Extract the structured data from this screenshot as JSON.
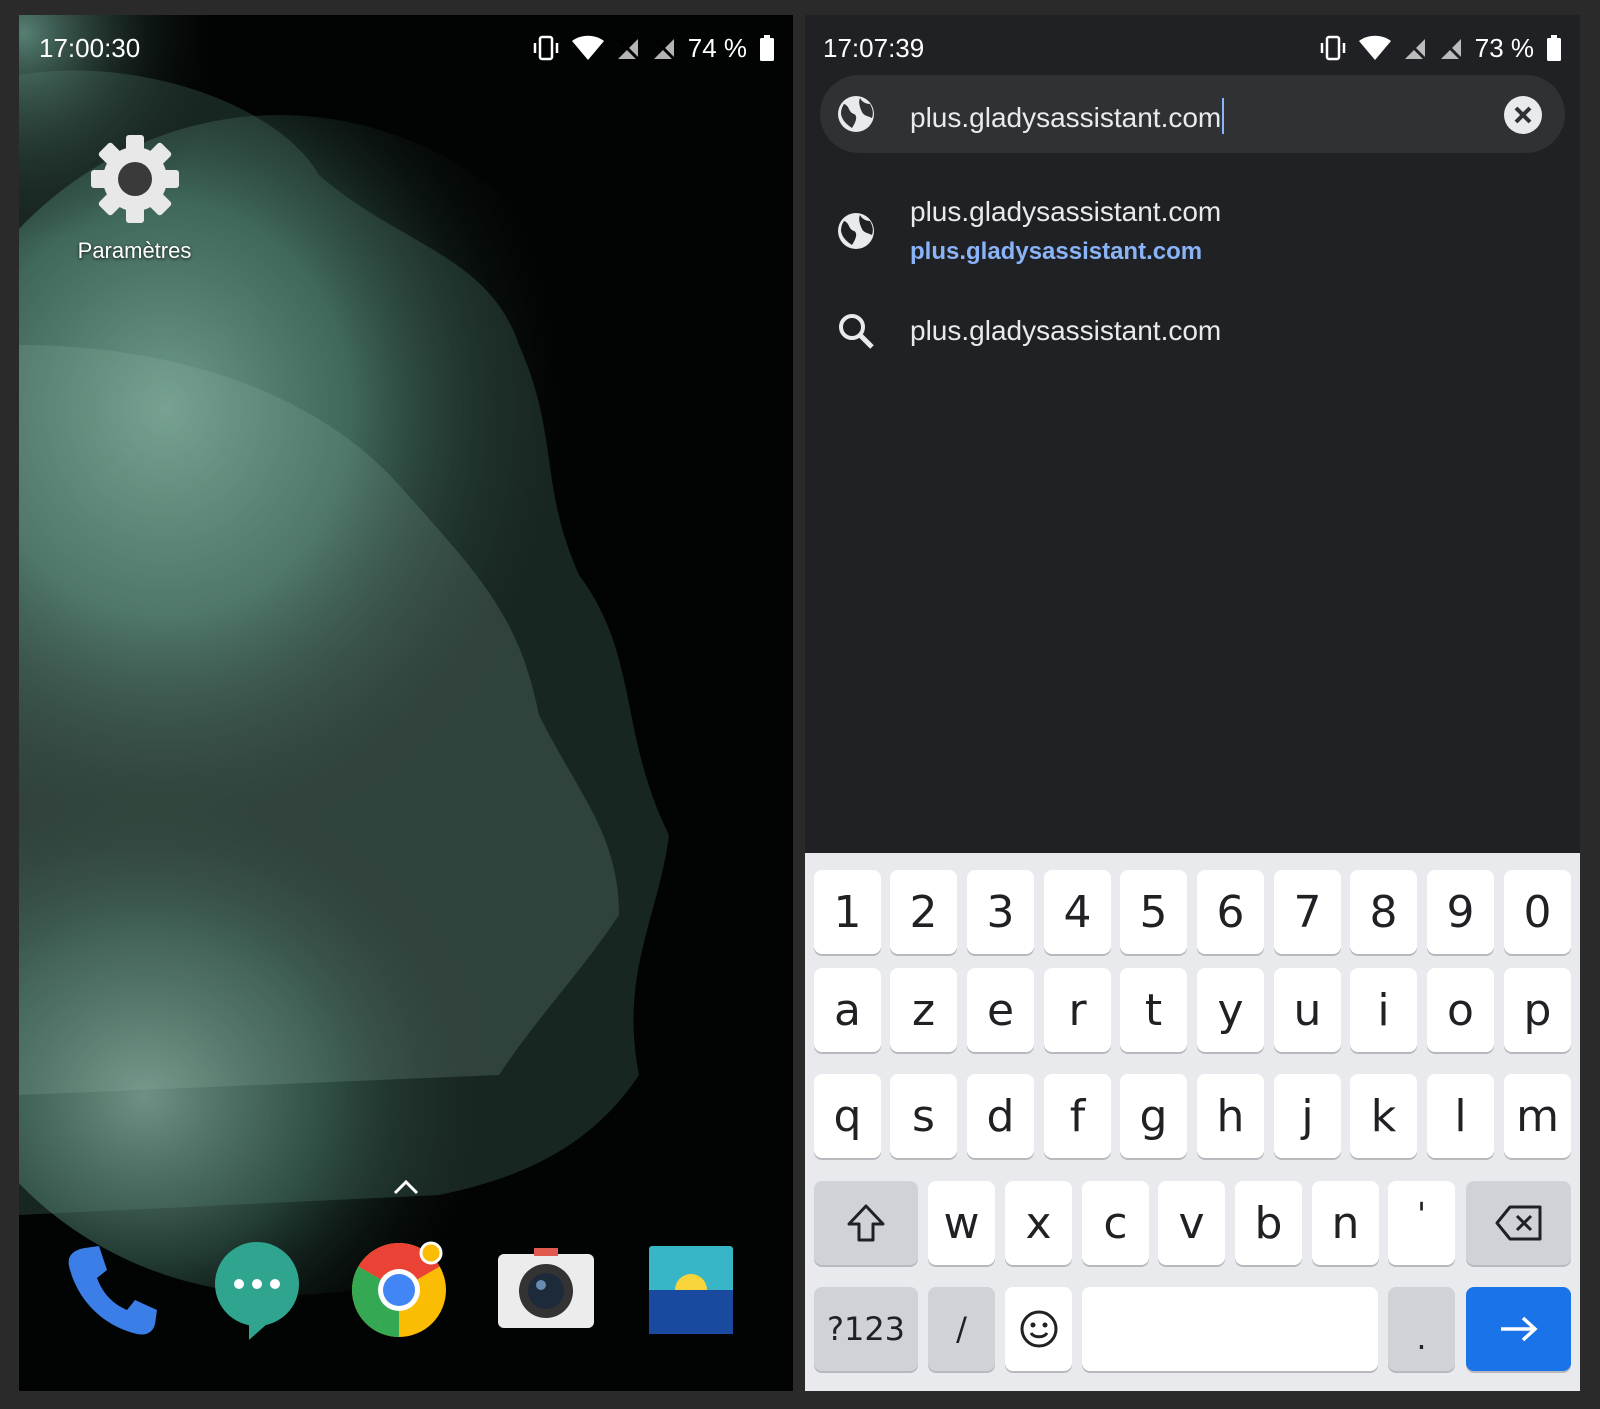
{
  "left_screen": {
    "status": {
      "time": "17:00:30",
      "battery": "74 %"
    },
    "apps": {
      "settings_label": "Paramètres"
    },
    "dock": [
      "phone",
      "messages",
      "chrome",
      "camera",
      "gallery"
    ]
  },
  "right_screen": {
    "status": {
      "time": "17:07:39",
      "battery": "73 %"
    },
    "url_bar": {
      "value": "plus.gladysassistant.com"
    },
    "suggestions": [
      {
        "icon": "globe-icon",
        "title": "plus.gladysassistant.com",
        "url": "plus.gladysassistant.com"
      },
      {
        "icon": "search-icon",
        "title": "plus.gladysassistant.com"
      }
    ],
    "keyboard": {
      "row1": [
        "1",
        "2",
        "3",
        "4",
        "5",
        "6",
        "7",
        "8",
        "9",
        "0"
      ],
      "row2": [
        "a",
        "z",
        "e",
        "r",
        "t",
        "y",
        "u",
        "i",
        "o",
        "p"
      ],
      "row3": [
        "q",
        "s",
        "d",
        "f",
        "g",
        "h",
        "j",
        "k",
        "l",
        "m"
      ],
      "row4": [
        "w",
        "x",
        "c",
        "v",
        "b",
        "n",
        "'"
      ],
      "symbols_label": "?123",
      "slash_label": "/",
      "period_label": "."
    }
  },
  "colors": {
    "accent_blue": "#1a73e8",
    "link_blue": "#8ab4f8",
    "browser_bg": "#202124"
  }
}
